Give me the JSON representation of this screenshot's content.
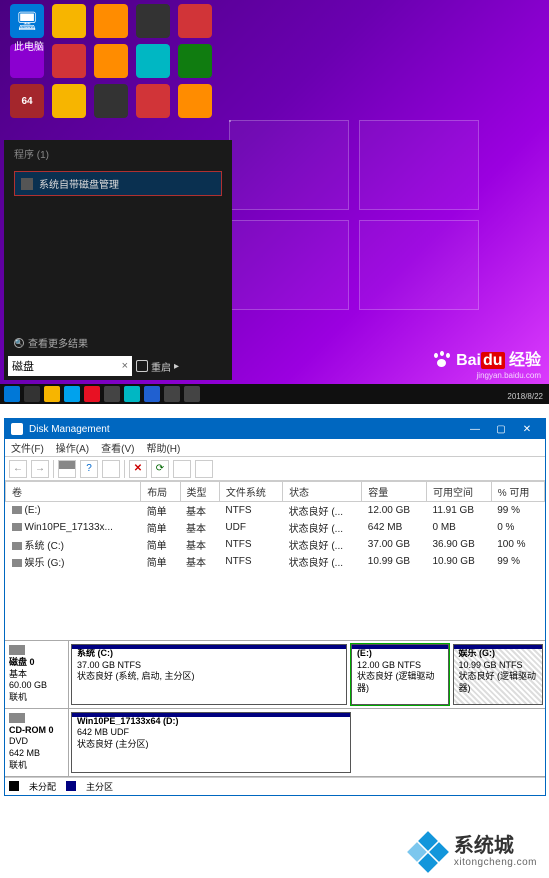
{
  "desktop": {
    "pc_label": "此电脑",
    "search_panel": {
      "header": "程序 (1)",
      "result": "系统自带磁盘管理",
      "more": "查看更多结果",
      "input_value": "磁盘",
      "restart": "重启"
    },
    "watermark": {
      "brand_prefix": "Bai",
      "brand_suffix": "du",
      "brand_cn": "经验",
      "url": "jingyan.baidu.com"
    },
    "date": "2018/8/22"
  },
  "dm": {
    "title": "Disk Management",
    "menu": [
      "文件(F)",
      "操作(A)",
      "查看(V)",
      "帮助(H)"
    ],
    "columns": [
      "卷",
      "布局",
      "类型",
      "文件系统",
      "状态",
      "容量",
      "可用空间",
      "% 可用"
    ],
    "volumes": [
      {
        "name": "(E:)",
        "layout": "简单",
        "type": "基本",
        "fs": "NTFS",
        "status": "状态良好 (...",
        "capacity": "12.00 GB",
        "free": "11.91 GB",
        "pct": "99 %"
      },
      {
        "name": "Win10PE_17133x...",
        "layout": "简单",
        "type": "基本",
        "fs": "UDF",
        "status": "状态良好 (...",
        "capacity": "642 MB",
        "free": "0 MB",
        "pct": "0 %"
      },
      {
        "name": "系统 (C:)",
        "layout": "简单",
        "type": "基本",
        "fs": "NTFS",
        "status": "状态良好 (...",
        "capacity": "37.00 GB",
        "free": "36.90 GB",
        "pct": "100 %"
      },
      {
        "name": "娱乐 (G:)",
        "layout": "简单",
        "type": "基本",
        "fs": "NTFS",
        "status": "状态良好 (...",
        "capacity": "10.99 GB",
        "free": "10.90 GB",
        "pct": "99 %"
      }
    ],
    "disk0": {
      "label": "磁盘 0",
      "type": "基本",
      "size": "60.00 GB",
      "status": "联机",
      "parts": [
        {
          "title": "系统 (C:)",
          "size": "37.00 GB NTFS",
          "status": "状态良好 (系统, 启动, 主分区)"
        },
        {
          "title": "(E:)",
          "size": "12.00 GB NTFS",
          "status": "状态良好 (逻辑驱动器)"
        },
        {
          "title": "娱乐 (G:)",
          "size": "10.99 GB NTFS",
          "status": "状态良好 (逻辑驱动器)"
        }
      ]
    },
    "cdrom": {
      "label": "CD-ROM 0",
      "type": "DVD",
      "size": "642 MB",
      "status": "联机",
      "part": {
        "title": "Win10PE_17133x64 (D:)",
        "size": "642 MB UDF",
        "status": "状态良好 (主分区)"
      }
    },
    "legend": {
      "unalloc": "未分配",
      "primary": "主分区"
    }
  },
  "footer": {
    "cn": "系统城",
    "en": "xitongcheng.com"
  }
}
